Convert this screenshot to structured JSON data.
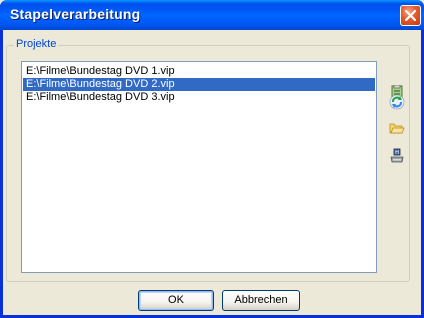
{
  "window": {
    "title": "Stapelverarbeitung"
  },
  "group": {
    "label": "Projekte"
  },
  "projects": {
    "items": [
      "E:\\Filme\\Bundestag DVD 1.vip",
      "E:\\Filme\\Bundestag DVD 2.vip",
      "E:\\Filme\\Bundestag DVD 3.vip"
    ],
    "selected_index": 1
  },
  "side_toolbar": {
    "icons": [
      "add-project-icon",
      "refresh-icon",
      "open-folder-icon",
      "save-icon"
    ]
  },
  "buttons": {
    "ok": "OK",
    "cancel": "Abbrechen"
  },
  "colors": {
    "titlebar": "#0058f6",
    "selection": "#316ac5",
    "group_label": "#0046d5",
    "close_button": "#e35b2e"
  }
}
